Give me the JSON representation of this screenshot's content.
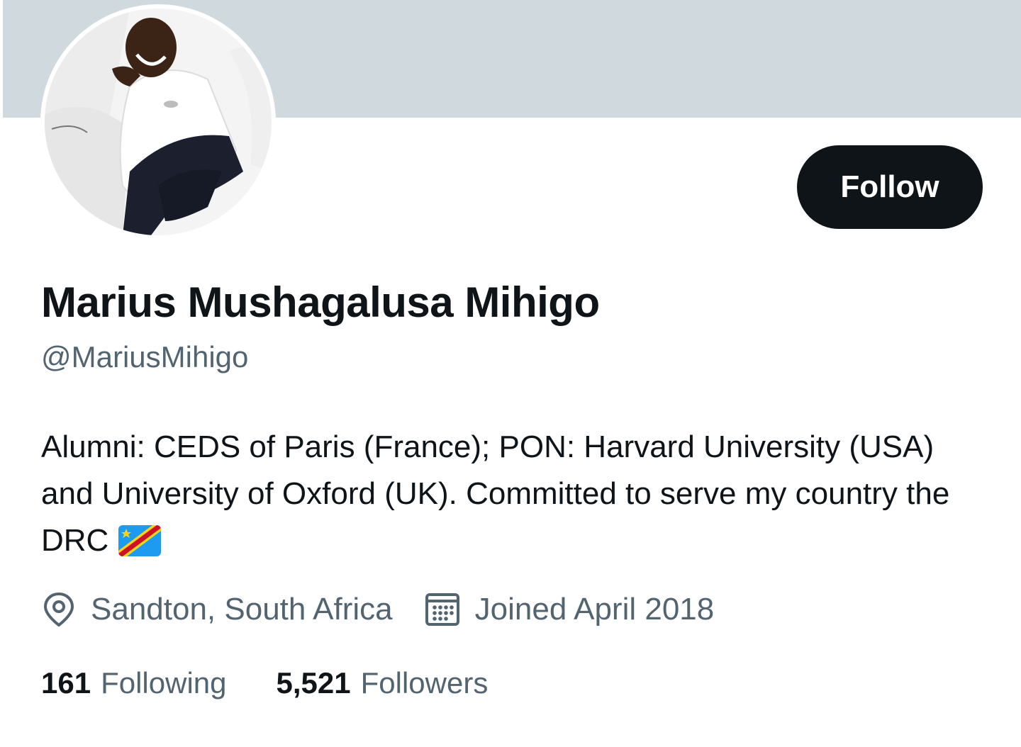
{
  "profile": {
    "display_name": "Marius Mushagalusa Mihigo",
    "handle": "@MariusMihigo",
    "bio": "Alumni: CEDS of Paris (France); PON: Harvard University (USA) and University of Oxford (UK). Committed to serve my country the DRC",
    "bio_emoji": "flag-drc",
    "location": "Sandton, South Africa",
    "joined": "Joined April 2018",
    "location_icon": "location-pin-icon",
    "joined_icon": "calendar-icon"
  },
  "actions": {
    "follow_label": "Follow"
  },
  "stats": {
    "following_count": "161",
    "following_label": "Following",
    "followers_count": "5,521",
    "followers_label": "Followers"
  },
  "colors": {
    "banner": "#cfd9de",
    "primary_text": "#0f1419",
    "secondary_text": "#536471",
    "follow_button_bg": "#0f1419",
    "follow_button_text": "#ffffff"
  }
}
